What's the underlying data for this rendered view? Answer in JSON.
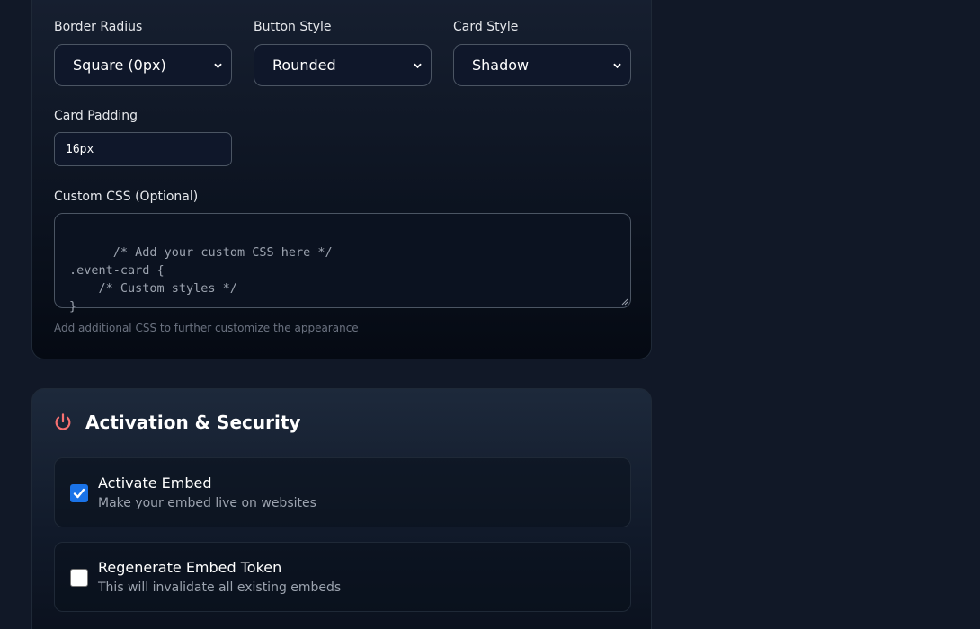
{
  "appearance": {
    "border_radius": {
      "label": "Border Radius",
      "value": "Square (0px)"
    },
    "button_style": {
      "label": "Button Style",
      "value": "Rounded"
    },
    "card_style": {
      "label": "Card Style",
      "value": "Shadow"
    },
    "card_padding": {
      "label": "Card Padding",
      "value": "16px"
    },
    "custom_css": {
      "label": "Custom CSS (Optional)",
      "placeholder": "/* Add your custom CSS here */\n.event-card {\n    /* Custom styles */\n}",
      "hint": "Add additional CSS to further customize the appearance"
    }
  },
  "security": {
    "title": "Activation & Security",
    "icon": "power-icon",
    "accent_color": "#f87171",
    "options": [
      {
        "title": "Activate Embed",
        "description": "Make your embed live on websites",
        "checked": true
      },
      {
        "title": "Regenerate Embed Token",
        "description": "This will invalidate all existing embeds",
        "checked": false
      }
    ]
  },
  "colors": {
    "background": "#111827",
    "checkbox_checked": "#1a73e8",
    "muted_text": "#9ca3af"
  }
}
